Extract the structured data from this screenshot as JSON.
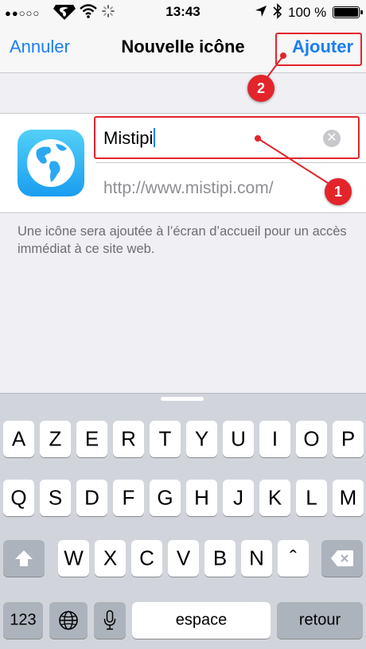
{
  "status_bar": {
    "signal": "●●○○○",
    "time": "13:43",
    "battery_percent": "100 %"
  },
  "nav": {
    "cancel_label": "Annuler",
    "title": "Nouvelle icône",
    "add_label": "Ajouter"
  },
  "form": {
    "name_value": "Mistipi",
    "url_value": "http://www.mistipi.com/",
    "clear_glyph": "✕"
  },
  "help_text": "Une icône sera ajoutée à l’écran d’accueil pour un accès immédiat à ce site web.",
  "annotations": [
    {
      "number": "1",
      "color": "#e3242b"
    },
    {
      "number": "2",
      "color": "#e3242b"
    }
  ],
  "keyboard": {
    "row1": [
      "A",
      "Z",
      "E",
      "R",
      "T",
      "Y",
      "U",
      "I",
      "O",
      "P"
    ],
    "row2": [
      "Q",
      "S",
      "D",
      "F",
      "G",
      "H",
      "J",
      "K",
      "L",
      "M"
    ],
    "row3": [
      "W",
      "X",
      "C",
      "V",
      "B",
      "N",
      "ˆ"
    ],
    "numbers_label": "123",
    "space_label": "espace",
    "return_label": "retour"
  },
  "colors": {
    "accent": "#1a7ef5",
    "annotation": "#e3242b",
    "background": "#efeff4",
    "keyboard": "#d1d5db"
  }
}
